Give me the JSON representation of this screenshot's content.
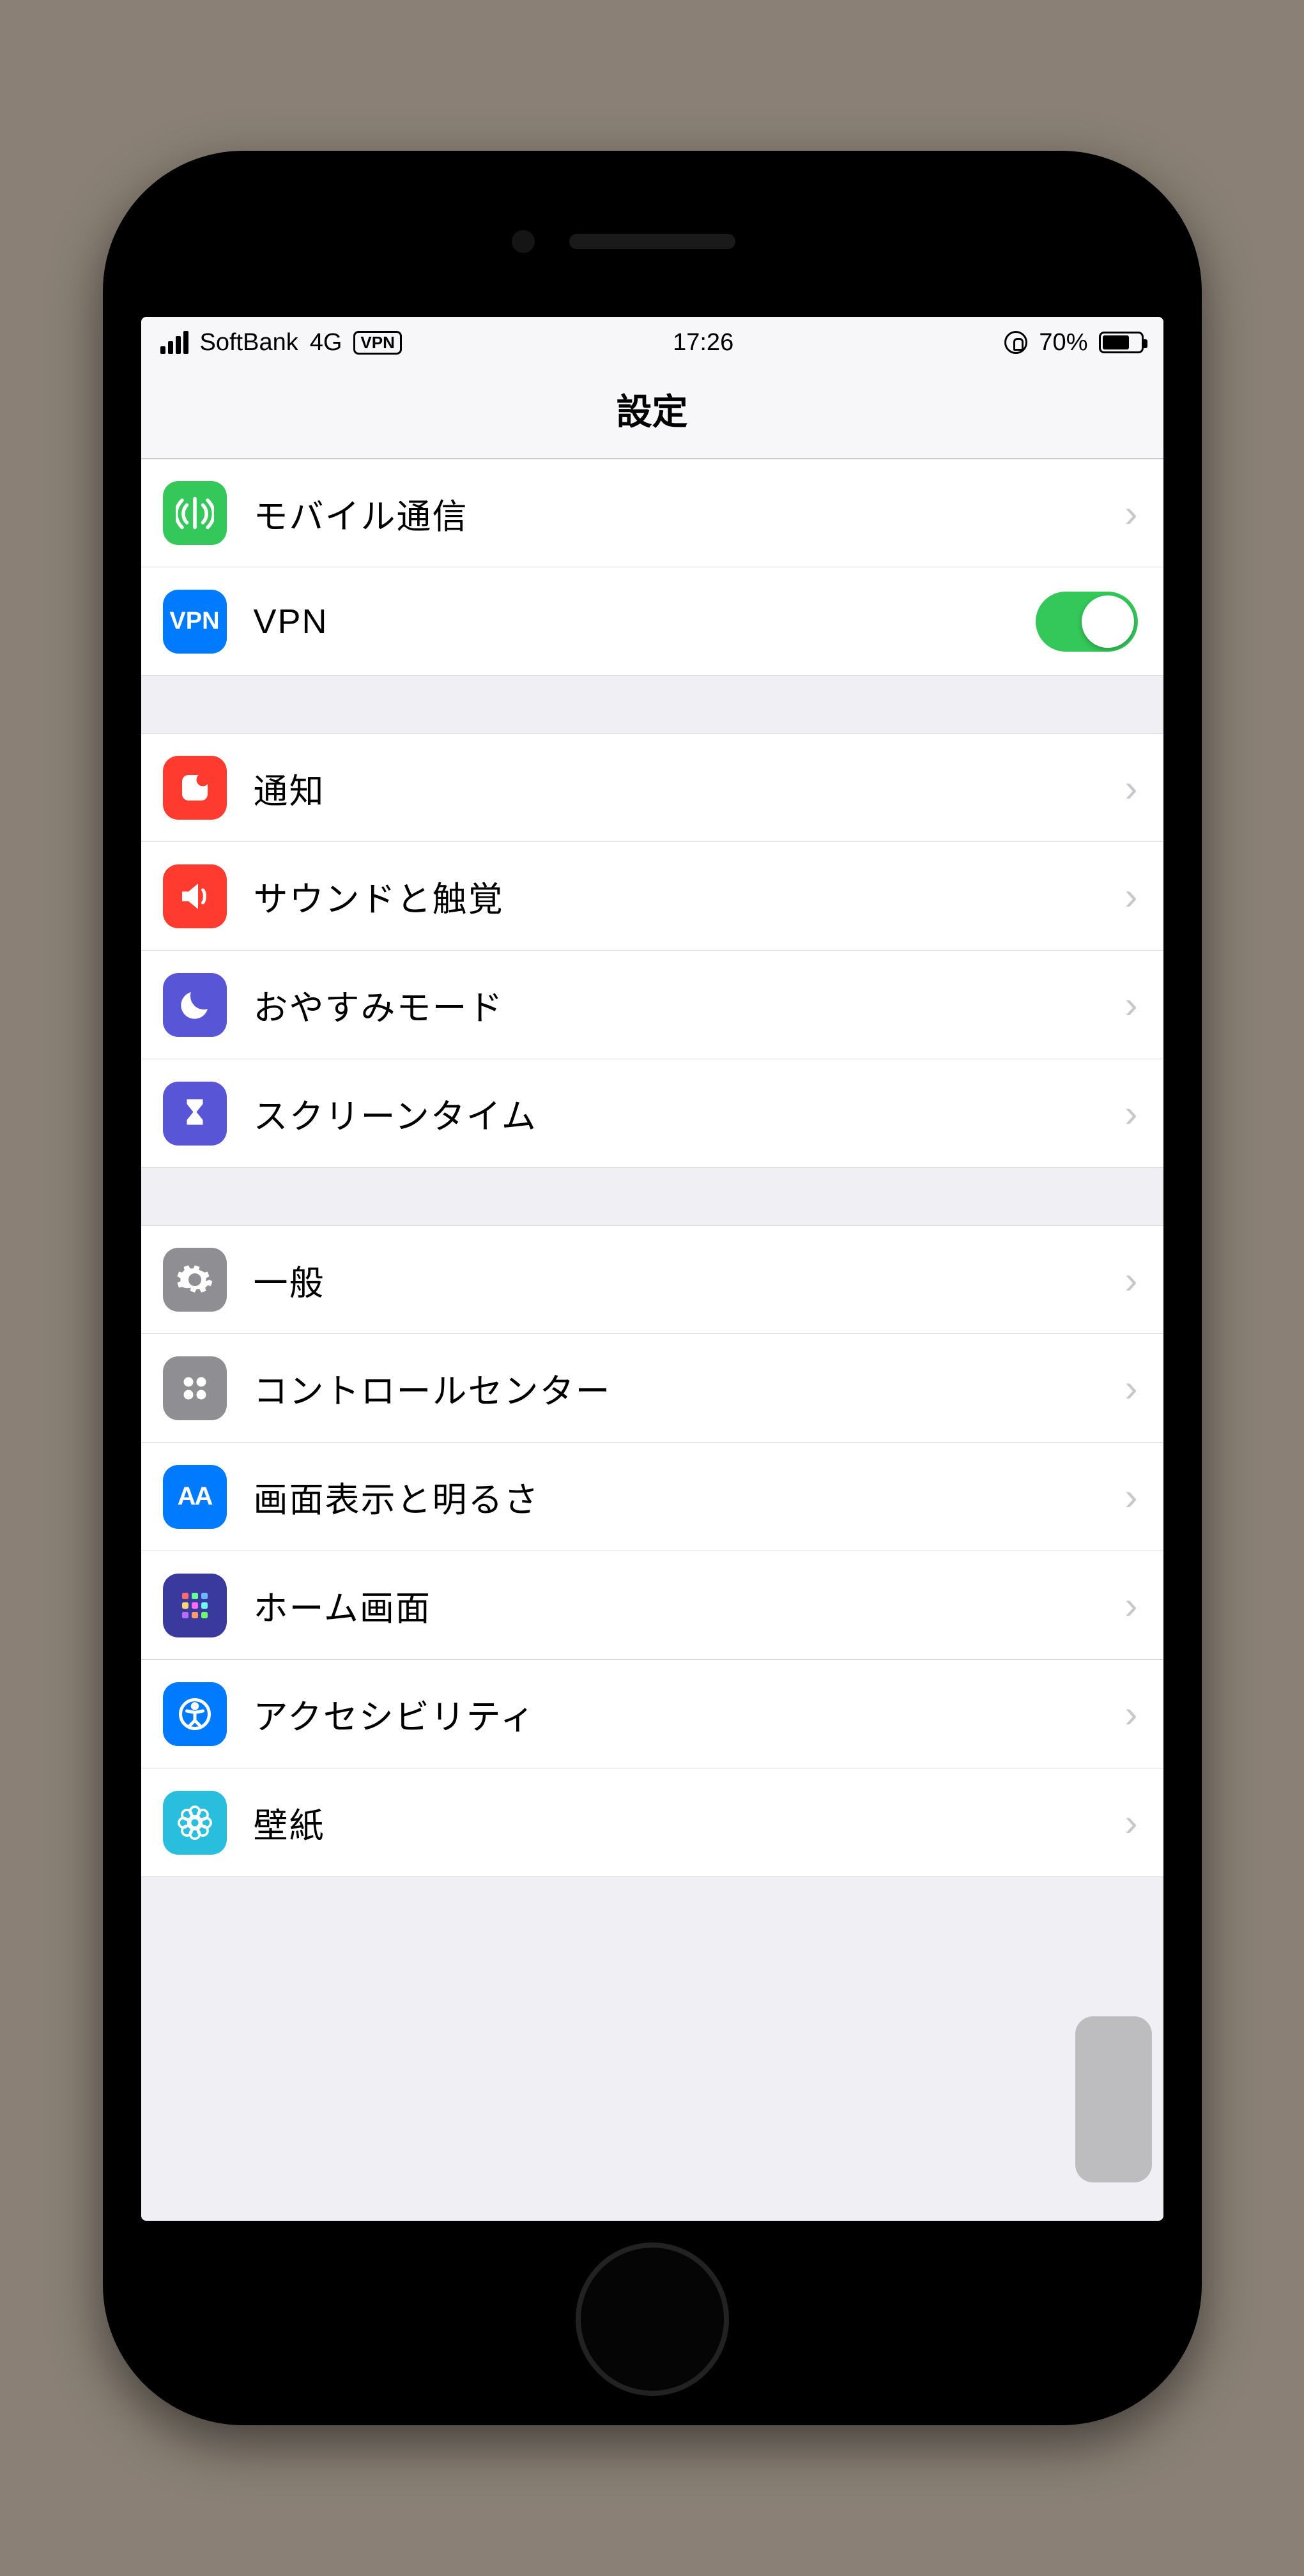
{
  "statusbar": {
    "carrier": "SoftBank",
    "network": "4G",
    "vpn_badge": "VPN",
    "time": "17:26",
    "battery_pct": "70%"
  },
  "nav": {
    "title": "設定"
  },
  "groups": [
    {
      "rows": [
        {
          "id": "cellular",
          "label": "モバイル通信",
          "icon": "cellular-icon",
          "accessory": "chevron"
        },
        {
          "id": "vpn",
          "label": "VPN",
          "icon": "vpn-icon",
          "accessory": "toggle",
          "toggle_on": true
        }
      ]
    },
    {
      "rows": [
        {
          "id": "notifications",
          "label": "通知",
          "icon": "notifications-icon",
          "accessory": "chevron"
        },
        {
          "id": "sounds",
          "label": "サウンドと触覚",
          "icon": "sounds-icon",
          "accessory": "chevron"
        },
        {
          "id": "dnd",
          "label": "おやすみモード",
          "icon": "moon-icon",
          "accessory": "chevron"
        },
        {
          "id": "screentime",
          "label": "スクリーンタイム",
          "icon": "hourglass-icon",
          "accessory": "chevron"
        }
      ]
    },
    {
      "rows": [
        {
          "id": "general",
          "label": "一般",
          "icon": "gear-icon",
          "accessory": "chevron"
        },
        {
          "id": "controlcenter",
          "label": "コントロールセンター",
          "icon": "control-center-icon",
          "accessory": "chevron"
        },
        {
          "id": "display",
          "label": "画面表示と明るさ",
          "icon": "display-icon",
          "accessory": "chevron"
        },
        {
          "id": "homescreen",
          "label": "ホーム画面",
          "icon": "home-grid-icon",
          "accessory": "chevron"
        },
        {
          "id": "accessibility",
          "label": "アクセシビリティ",
          "icon": "accessibility-icon",
          "accessory": "chevron"
        },
        {
          "id": "wallpaper",
          "label": "壁紙",
          "icon": "wallpaper-icon",
          "accessory": "chevron"
        }
      ]
    }
  ],
  "vpn_icon_text": "VPN",
  "display_icon_text": "AA"
}
